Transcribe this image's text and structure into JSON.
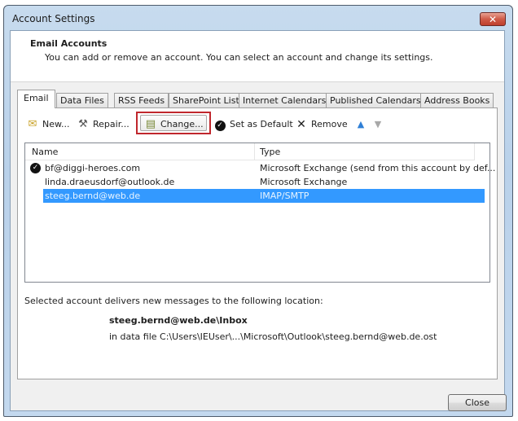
{
  "window": {
    "title": "Account Settings",
    "close_icon": "close-x-icon"
  },
  "header": {
    "title": "Email Accounts",
    "description": "You can add or remove an account. You can select an account and change its settings."
  },
  "tabs": [
    {
      "label": "Email",
      "active": true
    },
    {
      "label": "Data Files"
    },
    {
      "label": "RSS Feeds"
    },
    {
      "label": "SharePoint Lists"
    },
    {
      "label": "Internet Calendars"
    },
    {
      "label": "Published Calendars"
    },
    {
      "label": "Address Books"
    }
  ],
  "toolbar": {
    "new_label": "New...",
    "repair_label": "Repair...",
    "change_label": "Change...",
    "set_default_label": "Set as Default",
    "remove_label": "Remove",
    "icons": {
      "new": "new-account-icon",
      "repair": "repair-tools-icon",
      "change": "change-account-icon",
      "set_default": "checkmark-circle-icon",
      "remove": "x-icon",
      "move_up": "arrow-up-icon",
      "move_down": "arrow-down-icon"
    },
    "highlight_color": "#c0272d"
  },
  "accounts_list": {
    "columns": [
      "Name",
      "Type"
    ],
    "rows": [
      {
        "name": "bf@diggi-heroes.com",
        "type": "Microsoft Exchange (send from this account by def...",
        "default": true
      },
      {
        "name": "linda.draeusdorf@outlook.de",
        "type": "Microsoft Exchange"
      },
      {
        "name": "steeg.bernd@web.de",
        "type": "IMAP/SMTP",
        "selected": true
      }
    ],
    "selection_color": "#3399ff"
  },
  "delivery": {
    "label": "Selected account delivers new messages to the following location:",
    "path": "steeg.bernd@web.de\\Inbox",
    "data_file": "in data file C:\\Users\\IEUser\\...\\Microsoft\\Outlook\\steeg.bernd@web.de.ost"
  },
  "footer": {
    "close_label": "Close"
  }
}
